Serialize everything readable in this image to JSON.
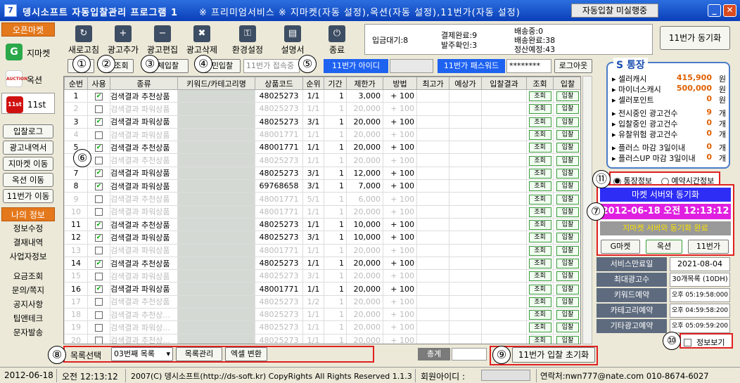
{
  "window": {
    "title": "뎅시소프트 자동입찰관리 프로그램 1",
    "subtitle": "※ 프리미엄서비스 ※ 지마켓(자동 설정),옥션(자동 설정),11번가(자동 설정)",
    "status": "자동입찰 미실행중",
    "icon": "7"
  },
  "sidebar": {
    "open_market_header": "오픈마켓",
    "markets": [
      {
        "name": "지마켓",
        "logo": "G",
        "color": "#2AA84A"
      },
      {
        "name": "옥션",
        "logo": "AUCTION",
        "color": "#D02020"
      },
      {
        "name": "11st",
        "logo": "11st",
        "color": "#D01010"
      }
    ],
    "buttons": [
      "입찰로그",
      "광고내역서",
      "지마켓 이동",
      "옥션 이동",
      "11번가 이동"
    ],
    "my_info_header": "나의 정보",
    "links1": [
      "정보수정",
      "결재내역",
      "사업자정보"
    ],
    "links2": [
      "요금조회",
      "문의/쪽지",
      "공지사항",
      "팁앤테크",
      "문자발송"
    ]
  },
  "toolbar": {
    "buttons": [
      {
        "label": "새로고침",
        "icon": "refresh-icon",
        "glyph": "↻"
      },
      {
        "label": "광고추가",
        "icon": "add-icon",
        "glyph": "+"
      },
      {
        "label": "광고편집",
        "icon": "edit-icon",
        "glyph": "−"
      },
      {
        "label": "광고삭제",
        "icon": "trash-icon",
        "glyph": "✖"
      },
      {
        "label": "환경설정",
        "icon": "lock-icon",
        "glyph": "⚿"
      },
      {
        "label": "설명서",
        "icon": "book-icon",
        "glyph": "▤"
      },
      {
        "label": "종료",
        "icon": "power-icon",
        "glyph": "⏻"
      }
    ],
    "info": {
      "waiting": "입금대기:8",
      "pay_done": "결제완료:9",
      "order_confirm": "발주확인:3",
      "shipping": "배송중:0",
      "ship_done": "배송완료:38",
      "settle": "정산예정:43"
    },
    "sync_label": "11번가 동기화"
  },
  "action_row": {
    "b1": "",
    "b2": "1조회",
    "b3": "체입찰",
    "b4": "민입찰",
    "login_status": "11번가 접속중",
    "id_label": "11번가 아이디",
    "id_value": "",
    "pw_label": "11번가 패스워드",
    "pw_value": "********",
    "logout": "로그아웃"
  },
  "badges": {
    "b1": "①",
    "b2": "②",
    "b3": "③",
    "b4": "④",
    "b5": "⑤",
    "b6": "⑥",
    "b7": "⑦",
    "b8": "⑧",
    "b9": "⑨",
    "b10": "⑩",
    "b11": "⑪"
  },
  "table": {
    "headers": [
      "순번",
      "사용",
      "종류",
      "키워드/카테고리명",
      "상품코드",
      "순위",
      "기간",
      "제한가",
      "방법",
      "최고가",
      "예상가",
      "입찰결과",
      "조회",
      "입찰"
    ],
    "btn_query": "조회",
    "btn_bid": "입찰",
    "rows": [
      {
        "no": "1",
        "on": true,
        "kind": "검색결과 추천상품",
        "code": "48025273",
        "rank": "1/1",
        "days": "1",
        "limit": "3,000",
        "method": "+ 100"
      },
      {
        "no": "2",
        "on": false,
        "kind": "검색결과 파워상품",
        "code": "48025273",
        "rank": "1/1",
        "days": "1",
        "limit": "20,000",
        "method": "+ 100"
      },
      {
        "no": "3",
        "on": true,
        "kind": "검색결과 파워상품",
        "code": "48025273",
        "rank": "3/1",
        "days": "1",
        "limit": "20,000",
        "method": "+ 100"
      },
      {
        "no": "4",
        "on": false,
        "kind": "검색결과 파워상품",
        "code": "48001771",
        "rank": "1/1",
        "days": "1",
        "limit": "20,000",
        "method": "+ 100"
      },
      {
        "no": "5",
        "on": true,
        "kind": "검색결과 추천상품",
        "code": "48001771",
        "rank": "1/1",
        "days": "1",
        "limit": "20,000",
        "method": "+ 100"
      },
      {
        "no": "6",
        "on": false,
        "kind": "검색결과 추천상품",
        "code": "48025273",
        "rank": "1/1",
        "days": "1",
        "limit": "20,000",
        "method": "+ 100"
      },
      {
        "no": "7",
        "on": true,
        "kind": "검색결과 파워상품",
        "code": "48025273",
        "rank": "3/1",
        "days": "1",
        "limit": "12,000",
        "method": "+ 100"
      },
      {
        "no": "8",
        "on": true,
        "kind": "검색결과 파워상품",
        "code": "69768658",
        "rank": "3/1",
        "days": "1",
        "limit": "7,000",
        "method": "+ 100"
      },
      {
        "no": "9",
        "on": false,
        "kind": "검색결과 추천상품",
        "code": "48001771",
        "rank": "5/1",
        "days": "1",
        "limit": "6,000",
        "method": "+ 100"
      },
      {
        "no": "10",
        "on": false,
        "kind": "검색결과 파워상품",
        "code": "48001771",
        "rank": "1/1",
        "days": "1",
        "limit": "20,000",
        "method": "+ 100"
      },
      {
        "no": "11",
        "on": true,
        "kind": "검색결과 추천상품",
        "code": "48025273",
        "rank": "1/1",
        "days": "1",
        "limit": "10,000",
        "method": "+ 100"
      },
      {
        "no": "12",
        "on": true,
        "kind": "검색결과 파워상품",
        "code": "48025273",
        "rank": "3/1",
        "days": "1",
        "limit": "10,000",
        "method": "+ 100"
      },
      {
        "no": "13",
        "on": false,
        "kind": "검색결과 파워상품",
        "code": "48001771",
        "rank": "1/1",
        "days": "1",
        "limit": "20,000",
        "method": "+ 100"
      },
      {
        "no": "14",
        "on": true,
        "kind": "검색결과 추천상품",
        "code": "48025273",
        "rank": "1/1",
        "days": "1",
        "limit": "20,000",
        "method": "+ 100"
      },
      {
        "no": "15",
        "on": false,
        "kind": "검색결과 파워상품",
        "code": "48025273",
        "rank": "3/1",
        "days": "1",
        "limit": "20,000",
        "method": "+ 100"
      },
      {
        "no": "16",
        "on": true,
        "kind": "검색결과 파워상품",
        "code": "48001771",
        "rank": "1/1",
        "days": "1",
        "limit": "20,000",
        "method": "+ 100"
      },
      {
        "no": "17",
        "on": false,
        "kind": "검색결과 추천상품",
        "code": "48025273",
        "rank": "1/2",
        "days": "1",
        "limit": "20,000",
        "method": "+ 100"
      },
      {
        "no": "18",
        "on": false,
        "kind": "검색결과 추천상...",
        "code": "48025273",
        "rank": "1/1",
        "days": "1",
        "limit": "20,000",
        "method": "+ 100"
      },
      {
        "no": "19",
        "on": false,
        "kind": "검색결과 파워상...",
        "code": "48025273",
        "rank": "1/1",
        "days": "1",
        "limit": "20,000",
        "method": "+ 100"
      },
      {
        "no": "20",
        "on": false,
        "kind": "검색결과 추천상...",
        "code": "48025273",
        "rank": "1/1",
        "days": "1",
        "limit": "20,000",
        "method": "+ 100"
      }
    ]
  },
  "bottom": {
    "list_select_label": "목록선택",
    "list_select_value": "03번째 목록",
    "manage": "목록관리",
    "excel": "엑셀 변환",
    "total_label": "총계",
    "total_value": "",
    "reset": "11번가 입찰 초기화"
  },
  "sbook": {
    "title": "S 통장",
    "rows": [
      {
        "k": "셀러캐시",
        "v": "415,900",
        "u": "원"
      },
      {
        "k": "마이너스캐시",
        "v": "500,000",
        "u": "원"
      },
      {
        "k": "셀러포인트",
        "v": "0",
        "u": "원"
      },
      {
        "k": "전시중인 광고건수",
        "v": "9",
        "u": "개"
      },
      {
        "k": "입찰중인 광고건수",
        "v": "0",
        "u": "개"
      },
      {
        "k": "유찰위험 광고건수",
        "v": "0",
        "u": "개"
      },
      {
        "k": "플러스 마감 3일이내",
        "v": "0",
        "u": "개"
      },
      {
        "k": "플러스UP 마감 3일이내",
        "v": "0",
        "u": "개"
      }
    ]
  },
  "radio": {
    "a": "통장정보",
    "b": "예약시간정보"
  },
  "sync_panel": {
    "line1": "마켓 서버와 동기화",
    "datetime": "2012-06-18 오전 12:13:12",
    "line3": "지마켓 서버와 동기화 완료",
    "g": "G마켓",
    "a": "옥션",
    "e": "11번가"
  },
  "details": [
    {
      "k": "서비스만료일",
      "v": "2021-08-04"
    },
    {
      "k": "최대광고수",
      "v": "30개목록 (10DH)"
    },
    {
      "k": "키워드예약",
      "v": "오후 05:19:58:000"
    },
    {
      "k": "카테고리예약",
      "v": "오후 04:59:58:200"
    },
    {
      "k": "기타광고예약",
      "v": "오후 05:09:59:200"
    }
  ],
  "info_toggle": "정보보기",
  "statusbar": {
    "date": "2012-06-18",
    "time": "오전 12:13:12",
    "copy": "2007(C) 뎅시소프트(http://ds-soft.kr) CopyRights All Rights Reserved 1.1.3",
    "member_label": "회원아이디 :",
    "member_value": "",
    "contact": "연락처:nwn777@nate.com 010-8674-6027"
  }
}
